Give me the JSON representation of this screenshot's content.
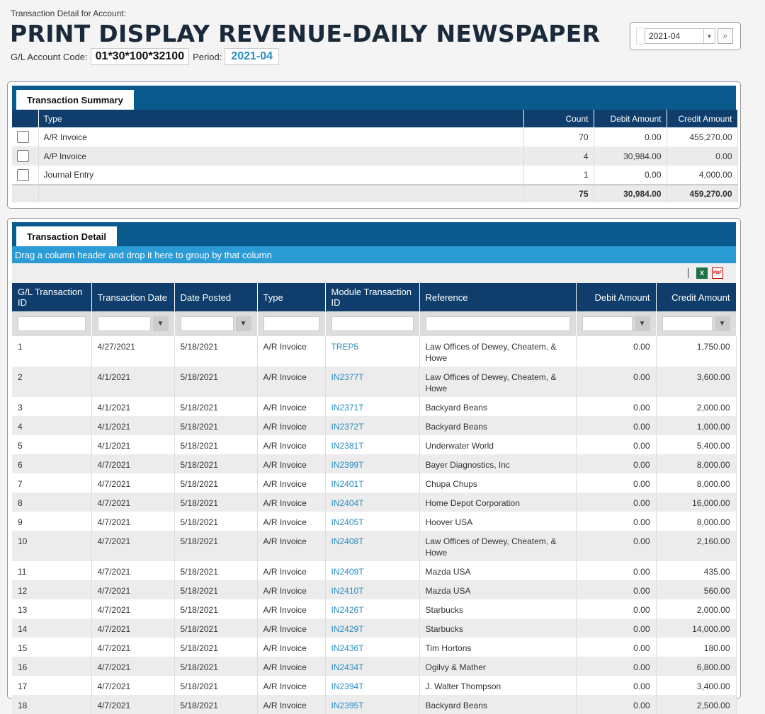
{
  "header": {
    "subtitle": "Transaction Detail for Account:",
    "title": "PRINT DISPLAY REVENUE-DAILY NEWSPAPER",
    "account_label": "G/L Account Code:",
    "account_code": "01*30*100*32100",
    "period_label": "Period:",
    "period_value": "2021-04"
  },
  "period_picker": {
    "selected": "2021-04"
  },
  "summary": {
    "tab": "Transaction Summary",
    "columns": [
      "Type",
      "Count",
      "Debit Amount",
      "Credit Amount"
    ],
    "rows": [
      {
        "type": "A/R Invoice",
        "count": "70",
        "debit": "0.00",
        "credit": "455,270.00"
      },
      {
        "type": "A/P Invoice",
        "count": "4",
        "debit": "30,984.00",
        "credit": "0.00"
      },
      {
        "type": "Journal Entry",
        "count": "1",
        "debit": "0.00",
        "credit": "4,000.00"
      }
    ],
    "totals": {
      "count": "75",
      "debit": "30,984.00",
      "credit": "459,270.00"
    }
  },
  "detail": {
    "tab": "Transaction Detail",
    "group_hint": "Drag a column header and drop it here to group by that column",
    "columns": [
      "G/L Transaction ID",
      "Transaction Date",
      "Date Posted",
      "Type",
      "Module Transaction ID",
      "Reference",
      "Debit Amount",
      "Credit Amount"
    ],
    "rows": [
      {
        "id": "1",
        "tdate": "4/27/2021",
        "posted": "5/18/2021",
        "type": "A/R Invoice",
        "mid": "TREP5",
        "ref": "Law Offices of Dewey, Cheatem, & Howe",
        "debit": "0.00",
        "credit": "1,750.00"
      },
      {
        "id": "2",
        "tdate": "4/1/2021",
        "posted": "5/18/2021",
        "type": "A/R Invoice",
        "mid": "IN2377T",
        "ref": "Law Offices of Dewey, Cheatem, & Howe",
        "debit": "0.00",
        "credit": "3,600.00"
      },
      {
        "id": "3",
        "tdate": "4/1/2021",
        "posted": "5/18/2021",
        "type": "A/R Invoice",
        "mid": "IN2371T",
        "ref": "Backyard Beans",
        "debit": "0.00",
        "credit": "2,000.00"
      },
      {
        "id": "4",
        "tdate": "4/1/2021",
        "posted": "5/18/2021",
        "type": "A/R Invoice",
        "mid": "IN2372T",
        "ref": "Backyard Beans",
        "debit": "0.00",
        "credit": "1,000.00"
      },
      {
        "id": "5",
        "tdate": "4/1/2021",
        "posted": "5/18/2021",
        "type": "A/R Invoice",
        "mid": "IN2381T",
        "ref": "Underwater World",
        "debit": "0.00",
        "credit": "5,400.00"
      },
      {
        "id": "6",
        "tdate": "4/7/2021",
        "posted": "5/18/2021",
        "type": "A/R Invoice",
        "mid": "IN2399T",
        "ref": "Bayer Diagnostics, Inc",
        "debit": "0.00",
        "credit": "8,000.00"
      },
      {
        "id": "7",
        "tdate": "4/7/2021",
        "posted": "5/18/2021",
        "type": "A/R Invoice",
        "mid": "IN2401T",
        "ref": "Chupa Chups",
        "debit": "0.00",
        "credit": "8,000.00"
      },
      {
        "id": "8",
        "tdate": "4/7/2021",
        "posted": "5/18/2021",
        "type": "A/R Invoice",
        "mid": "IN2404T",
        "ref": "Home Depot Corporation",
        "debit": "0.00",
        "credit": "16,000.00"
      },
      {
        "id": "9",
        "tdate": "4/7/2021",
        "posted": "5/18/2021",
        "type": "A/R Invoice",
        "mid": "IN2405T",
        "ref": "Hoover USA",
        "debit": "0.00",
        "credit": "8,000.00"
      },
      {
        "id": "10",
        "tdate": "4/7/2021",
        "posted": "5/18/2021",
        "type": "A/R Invoice",
        "mid": "IN2408T",
        "ref": "Law Offices of Dewey, Cheatem, & Howe",
        "debit": "0.00",
        "credit": "2,160.00"
      },
      {
        "id": "11",
        "tdate": "4/7/2021",
        "posted": "5/18/2021",
        "type": "A/R Invoice",
        "mid": "IN2409T",
        "ref": "Mazda USA",
        "debit": "0.00",
        "credit": "435.00"
      },
      {
        "id": "12",
        "tdate": "4/7/2021",
        "posted": "5/18/2021",
        "type": "A/R Invoice",
        "mid": "IN2410T",
        "ref": "Mazda USA",
        "debit": "0.00",
        "credit": "560.00"
      },
      {
        "id": "13",
        "tdate": "4/7/2021",
        "posted": "5/18/2021",
        "type": "A/R Invoice",
        "mid": "IN2426T",
        "ref": "Starbucks",
        "debit": "0.00",
        "credit": "2,000.00"
      },
      {
        "id": "14",
        "tdate": "4/7/2021",
        "posted": "5/18/2021",
        "type": "A/R Invoice",
        "mid": "IN2429T",
        "ref": "Starbucks",
        "debit": "0.00",
        "credit": "14,000.00"
      },
      {
        "id": "15",
        "tdate": "4/7/2021",
        "posted": "5/18/2021",
        "type": "A/R Invoice",
        "mid": "IN2436T",
        "ref": "Tim Hortons",
        "debit": "0.00",
        "credit": "180.00"
      },
      {
        "id": "16",
        "tdate": "4/7/2021",
        "posted": "5/18/2021",
        "type": "A/R Invoice",
        "mid": "IN2434T",
        "ref": "Ogilvy & Mather",
        "debit": "0.00",
        "credit": "6,800.00"
      },
      {
        "id": "17",
        "tdate": "4/7/2021",
        "posted": "5/18/2021",
        "type": "A/R Invoice",
        "mid": "IN2394T",
        "ref": "J. Walter Thompson",
        "debit": "0.00",
        "credit": "3,400.00"
      },
      {
        "id": "18",
        "tdate": "4/7/2021",
        "posted": "5/18/2021",
        "type": "A/R Invoice",
        "mid": "IN2395T",
        "ref": "Backyard Beans",
        "debit": "0.00",
        "credit": "2,500.00"
      }
    ]
  },
  "icons": {
    "excel": "excel-export-icon",
    "pdf": "pdf-export-icon",
    "filter": "filter-icon",
    "search": "search-icon",
    "dropdown": "chevron-down-icon"
  },
  "colors": {
    "panel_header": "#0b5a8e",
    "table_header": "#0f3e6c",
    "group_bar": "#2a9bd4",
    "link": "#2a8cc0"
  }
}
